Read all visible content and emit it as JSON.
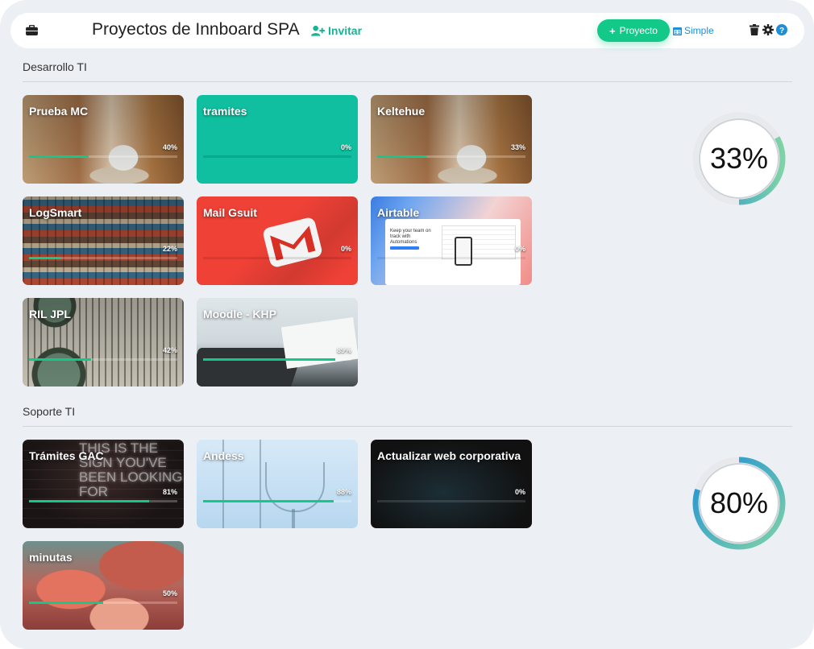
{
  "header": {
    "title": "Proyectos de Innboard SPA",
    "invite_label": "Invitar",
    "new_project_label": "Proyecto",
    "view_label": "Simple"
  },
  "colors": {
    "accent": "#13c98a",
    "invite": "#17b394",
    "link": "#1e8fd6",
    "background": "#eceff4"
  },
  "sections": [
    {
      "title": "Desarrollo TI",
      "progress": 33,
      "progress_label": "33%",
      "projects": [
        {
          "name": "Prueba MC",
          "percent": 40,
          "percent_label": "40%",
          "background": "coffee"
        },
        {
          "name": "tramites",
          "percent": 0,
          "percent_label": "0%",
          "background": "teal"
        },
        {
          "name": "Keltehue",
          "percent": 33,
          "percent_label": "33%",
          "background": "coffee"
        },
        {
          "name": "LogSmart",
          "percent": 22,
          "percent_label": "22%",
          "background": "containers"
        },
        {
          "name": "Mail Gsuit",
          "percent": 0,
          "percent_label": "0%",
          "background": "gmail"
        },
        {
          "name": "Airtable",
          "percent": 0,
          "percent_label": "0%",
          "background": "airtable"
        },
        {
          "name": "RIL JPL",
          "percent": 42,
          "percent_label": "42%",
          "background": "water-plant"
        },
        {
          "name": "Moodle - KHP",
          "percent": 89,
          "percent_label": "89%",
          "background": "laptop"
        }
      ]
    },
    {
      "title": "Soporte TI",
      "progress": 80,
      "progress_label": "80%",
      "projects": [
        {
          "name": "Trámites GAC",
          "percent": 81,
          "percent_label": "81%",
          "background": "neon"
        },
        {
          "name": "Andess",
          "percent": 88,
          "percent_label": "88%",
          "background": "glass"
        },
        {
          "name": "Actualizar web corporativa",
          "percent": 0,
          "percent_label": "0%",
          "background": "dark"
        },
        {
          "name": "minutas",
          "percent": 50,
          "percent_label": "50%",
          "background": "clouds"
        }
      ]
    }
  ],
  "neon_sign_text": "THIS IS THE SIGN YOU'VE BEEN LOOKING FOR",
  "airtable_promo_text": "Keep your team on track with Automations"
}
